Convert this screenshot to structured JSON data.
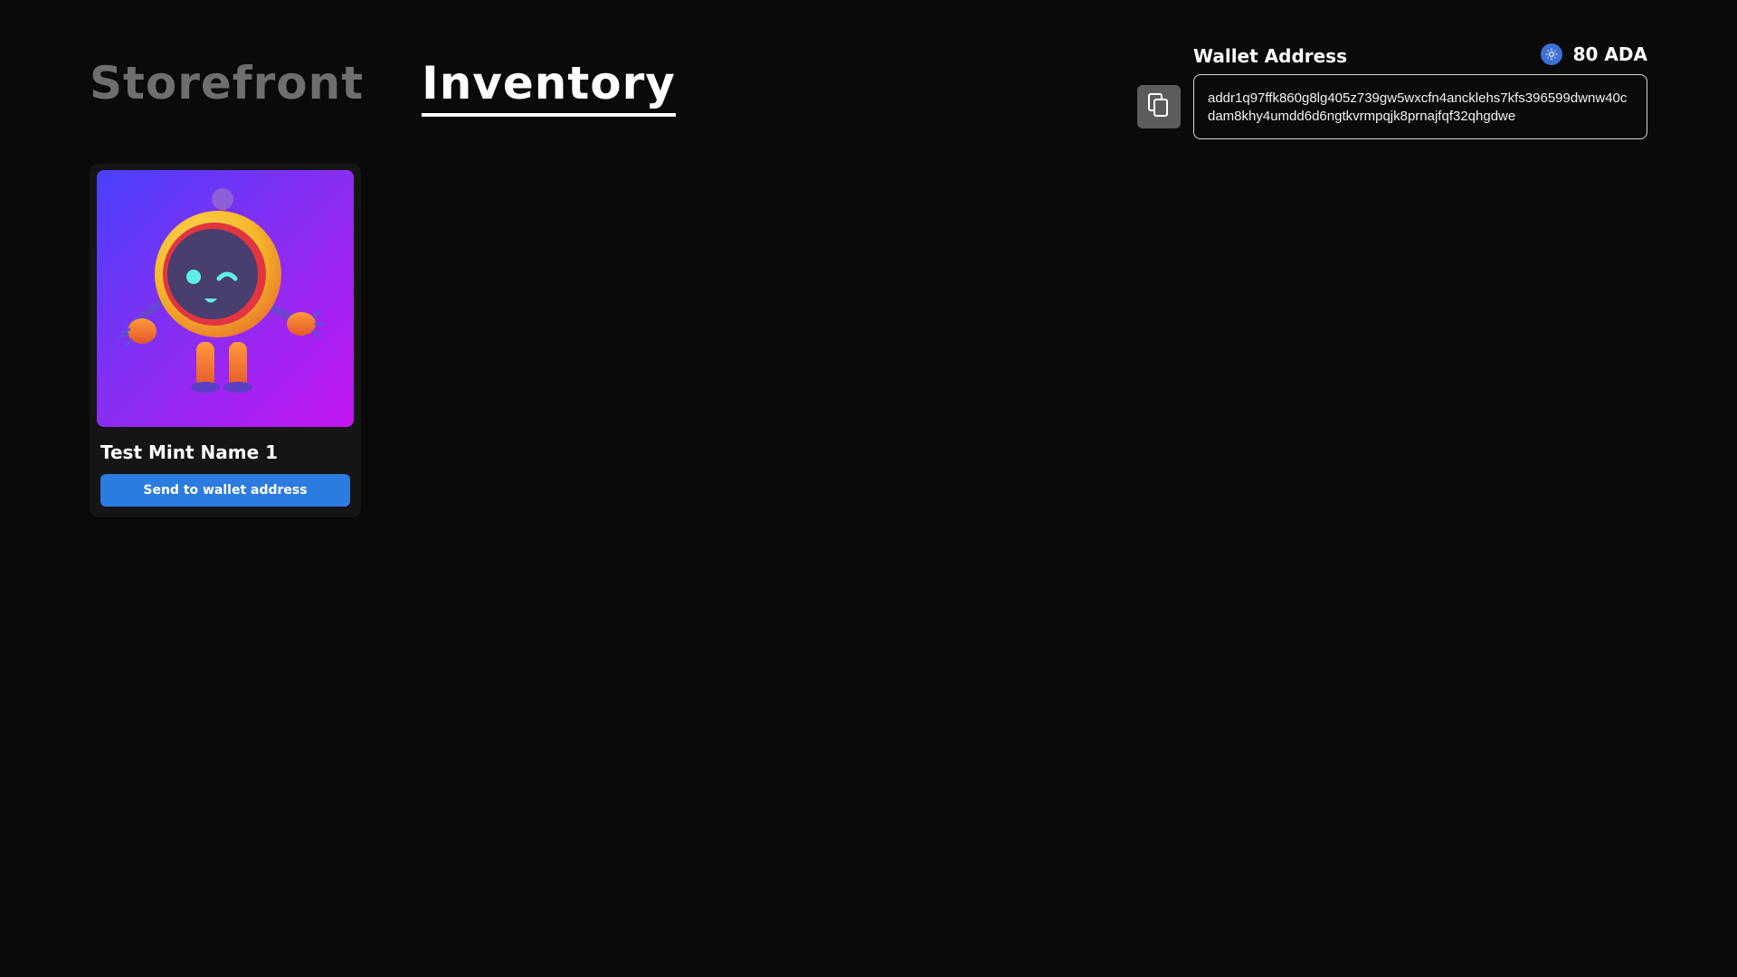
{
  "nav": {
    "tabs": [
      {
        "label": "Storefront",
        "active": false
      },
      {
        "label": "Inventory",
        "active": true
      }
    ]
  },
  "wallet": {
    "label": "Wallet Address",
    "balance": "80 ADA",
    "address": "addr1q97ffk860g8lg405z739gw5wxcfn4ancklehs7kfs396599dwnw40cdam8khy4umdd6d6ngtkvrmpqjk8prnajfqf32qhgdwe",
    "copy_icon": "copy-icon",
    "currency_icon": "cardano-icon"
  },
  "inventory": {
    "items": [
      {
        "name": "Test Mint Name 1",
        "action_label": "Send to wallet address",
        "image_icon": "robot-mascot"
      }
    ]
  },
  "colors": {
    "background": "#0a0a0a",
    "card_background": "#151515",
    "accent_button": "#2b7be0",
    "inactive_tab": "#6e6e6e",
    "image_gradient_start": "#4a40ff",
    "image_gradient_end": "#c416f2"
  }
}
